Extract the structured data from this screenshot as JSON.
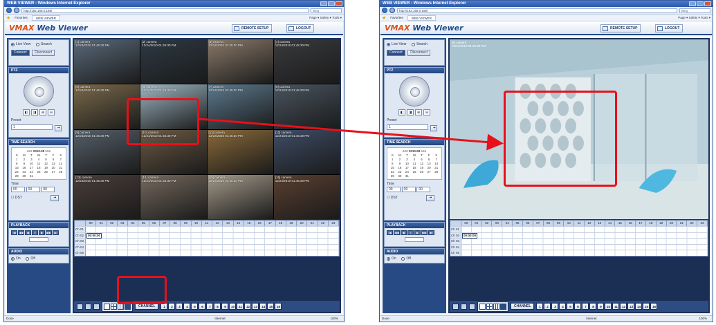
{
  "browser": {
    "title": "WEB VIEWER - Windows Internet Explorer",
    "url": "http://192.168.0.158/",
    "search_placeholder": "Bing",
    "fav_label": "Favorites",
    "tab_label": "WEB VIEWER",
    "tools_label": "Page ▾  Safety ▾  Tools ▾",
    "status_left": "Done",
    "status_zone": "Internet",
    "status_zoom": "100%"
  },
  "app": {
    "logo_a": "VMAX",
    "logo_b": " Web Viewer",
    "remote_setup": "REMOTE SETUP",
    "logout": "LOGOUT"
  },
  "side": {
    "live_view": "Live View",
    "search": "Search",
    "connect": "Connect",
    "disconnect": "Disconnect",
    "ptz_title": "PTZ",
    "preset_label": "Preset",
    "preset_value": "1",
    "time_search_title": "TIME SEARCH",
    "cal_title": "<<< 2010.08 >>>",
    "cal_days": [
      "S",
      "M",
      "T",
      "W",
      "T",
      "F",
      "S",
      "1",
      "2",
      "3",
      "4",
      "5",
      "6",
      "7",
      "8",
      "9",
      "10",
      "11",
      "12",
      "13",
      "14",
      "15",
      "16",
      "17",
      "18",
      "19",
      "20",
      "21",
      "22",
      "23",
      "24",
      "25",
      "26",
      "27",
      "28",
      "29",
      "30",
      "31"
    ],
    "time_label": "Time",
    "hh": "00",
    "mm": "00",
    "ss": "00",
    "dst_label": "DST",
    "playback_title": "PLAYBACK",
    "audio_title": "AUDIO",
    "audio_on": "On",
    "audio_off": "Off"
  },
  "cameras": [
    {
      "label": "[1] camera\n12/24/2010 01:45:30 PM",
      "color": "#5a6a7a"
    },
    {
      "label": "[2] camera\n12/24/2010 01:45:30 PM",
      "color": "#2e3a44"
    },
    {
      "label": "[3] camera\n12/24/2010 01:45:30 PM",
      "color": "#8a7a6a"
    },
    {
      "label": "[4] camera\n12/24/2010 01:45:30 PM",
      "color": "#3a3b3e"
    },
    {
      "label": "[5] camera\n12/24/2010 01:45:30 PM",
      "color": "#7a6a4a"
    },
    {
      "label": "[6] camera\n12/24/2010 01:45:30 PM",
      "color": "#9fb7c3"
    },
    {
      "label": "[7] camera\n12/24/2010 01:45:30 PM",
      "color": "#5d7a8e"
    },
    {
      "label": "[8] camera\n12/24/2010 01:45:30 PM",
      "color": "#4a5560"
    },
    {
      "label": "[9] camera\n12/24/2010 01:45:30 PM",
      "color": "#55606a"
    },
    {
      "label": "[10] camera\n12/24/2010 01:45:30 PM",
      "color": "#6c5a45"
    },
    {
      "label": "[11] camera\n12/24/2010 01:45:30 PM",
      "color": "#8a6a3a"
    },
    {
      "label": "[12] camera\n12/24/2010 01:45:30 PM",
      "color": "#3e4d66"
    },
    {
      "label": "[13] camera\n12/24/2010 01:45:30 PM",
      "color": "#4a3e3a"
    },
    {
      "label": "[14] camera\n12/24/2010 01:45:30 PM",
      "color": "#766a5e"
    },
    {
      "label": "[15] camera\n12/24/2010 01:45:30 PM",
      "color": "#a49a8a"
    },
    {
      "label": "[16] camera\n12/24/2010 01:45:30 PM",
      "color": "#5a4030"
    }
  ],
  "big_camera_label": "[6] camera\n12/24/2010 01:45:30 PM",
  "timeline": {
    "hours": [
      "00",
      "01",
      "02",
      "03",
      "04",
      "05",
      "06",
      "07",
      "08",
      "09",
      "10",
      "11",
      "12",
      "13",
      "14",
      "15",
      "16",
      "17",
      "18",
      "19",
      "20",
      "21",
      "22",
      "23"
    ],
    "rows": [
      "Ch 01",
      "Ch 02",
      "Ch 03",
      "Ch 04",
      "Ch 05"
    ],
    "time_value": "00:00:00"
  },
  "bottom": {
    "channel_label": "CHANNEL",
    "channels": [
      "1",
      "2",
      "3",
      "4",
      "5",
      "6",
      "7",
      "8",
      "9",
      "10",
      "11",
      "12",
      "13",
      "14",
      "15",
      "16"
    ]
  }
}
